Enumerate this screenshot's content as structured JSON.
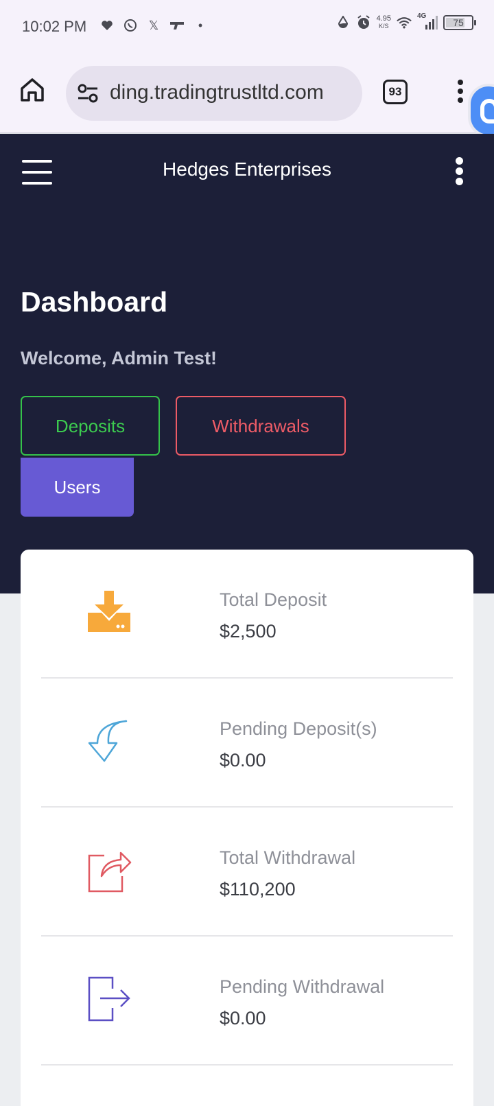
{
  "status_bar": {
    "time": "10:02 PM",
    "net_speed": "4.95",
    "net_unit": "K/S",
    "network": "4G",
    "battery": "75",
    "battery_level": 0.75
  },
  "browser": {
    "url": "ding.tradingtrustltd.com",
    "tab_count": "93"
  },
  "app": {
    "title": "Hedges Enterprises",
    "page_title": "Dashboard",
    "welcome": "Welcome, Admin Test!"
  },
  "actions": {
    "deposits": "Deposits",
    "withdrawals": "Withdrawals",
    "users": "Users"
  },
  "stats": [
    {
      "label": "Total Deposit",
      "value": "$2,500",
      "icon": "download-tray-icon",
      "color": "#f7a93b"
    },
    {
      "label": "Pending Deposit(s)",
      "value": "$0.00",
      "icon": "curved-arrow-icon",
      "color": "#4ea6d8"
    },
    {
      "label": "Total Withdrawal",
      "value": "$110,200",
      "icon": "share-out-icon",
      "color": "#e05a62"
    },
    {
      "label": "Pending Withdrawal",
      "value": "$0.00",
      "icon": "exit-arrow-icon",
      "color": "#5b4fc4"
    }
  ],
  "colors": {
    "header_bg": "#1c1f38",
    "deposits": "#3ccb4f",
    "withdrawals": "#ef5c67",
    "users": "#675ad4"
  }
}
